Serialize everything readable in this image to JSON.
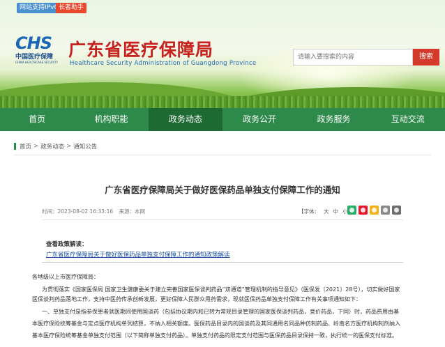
{
  "header": {
    "badge_ipv6": "网站支持IPv6",
    "badge_elder": "长者助手",
    "logo_mark": "CHS",
    "logo_cn": "中国医疗保障",
    "logo_en": "CHINA HEALTHCARE SECURITY",
    "title_cn": "广东省医疗保障局",
    "title_en": "Healthcare Security Administration of Guangdong Province",
    "search_placeholder": "请输入要搜索的内容",
    "search_button": "搜索"
  },
  "nav": {
    "items": [
      "首页",
      "机构职能",
      "政务动态",
      "政务公开",
      "政务服务",
      "互动交流"
    ],
    "active_index": 2
  },
  "breadcrumb": {
    "items": [
      "首页",
      "政务动态",
      "通知公告"
    ],
    "separator": ">"
  },
  "article": {
    "title": "广东省医疗保障局关于做好医保药品单独支付保障工作的通知",
    "time": "时间：2023-08-02 16:33:16",
    "source": "来源：本网",
    "font_label": "【字体：",
    "font_large": "大",
    "font_medium": "中",
    "font_small": "小",
    "font_end": "】",
    "policy_label": "查看政策解读：",
    "policy_link": "广东省医疗保障局关于做好医保药品单独支付保障工作的通知政策解读",
    "salutation": "各地级以上市医疗保障局：",
    "para1_line1": "为贯彻落实《国家医保局 国家卫生健康委关于建立完善国家医保谈判药品“双通道”管理机制的指导意见》（医保发〔2021〕28号），切实做好国家",
    "para1_line2": "医保谈判药品落地工作，支持中医药传承创新发展，更好保障人民群众用药需求，现就医保药品单独支付保障工作有关事项通知如下：",
    "para2_line1": "一、单独支付是指参保患者就医期间使用国谈药（包括协议期内和已转为常规目录管理的国家医保谈判药品，竞价药品，下同）时，药品费用由基",
    "para2_line2": "本医疗保险统筹基金与定点医疗机构单列结算，不纳入相关额度。医保药品目录内的国谈药及其同通用名同品种仿制药品、岭南名方医疗机构制剂纳入",
    "para2_line3": "基本医疗保险统筹基金单独支付范围（以下简称单独支付药品）。单独支付药品的限定支付范围与医保药品目录保持一致，执行统一的医保支付标准。"
  },
  "colors": {
    "nav_bg": "#2e8a4a",
    "nav_active": "#1e6a33",
    "title_red": "#c8201c",
    "search_button": "#d43a2b",
    "link_blue": "#1a4fa0"
  },
  "icons": [
    "wechat-share-icon",
    "weibo-share-icon",
    "qzone-share-icon",
    "print-icon",
    "close-icon"
  ]
}
